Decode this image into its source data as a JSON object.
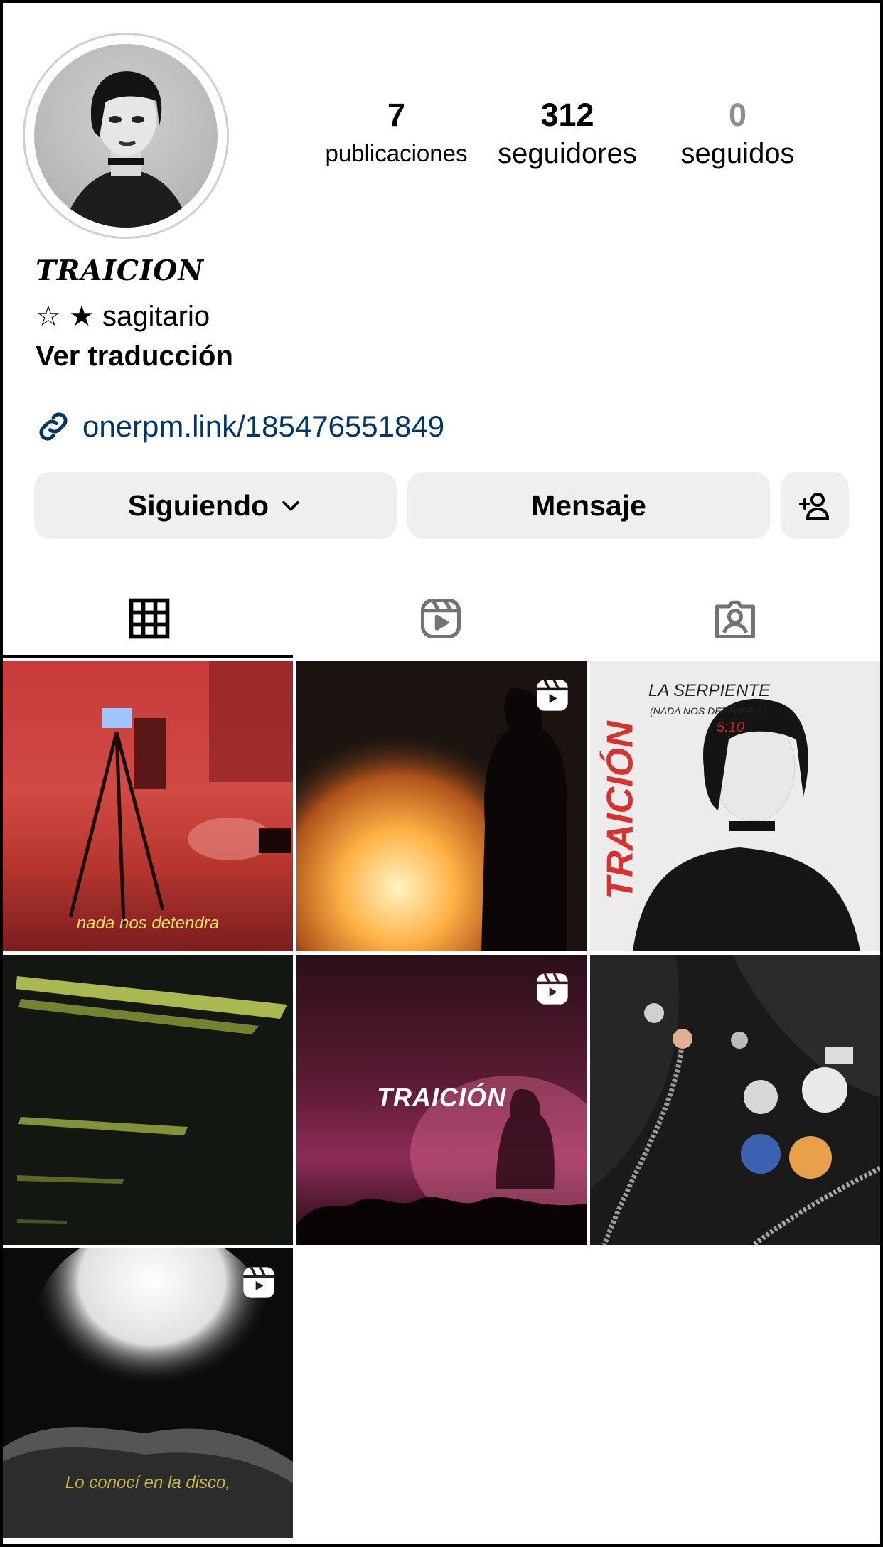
{
  "profile": {
    "display_name": "TRAICION",
    "bio_line": "☆ ★ sagitario",
    "translate_label": "Ver traducción",
    "link": "onerpm.link/185476551849"
  },
  "stats": {
    "posts": {
      "value": "7",
      "label": "publicaciones"
    },
    "followers": {
      "value": "312",
      "label": "seguidores"
    },
    "following": {
      "value": "0",
      "label": "seguidos"
    }
  },
  "actions": {
    "following_label": "Siguiendo",
    "message_label": "Mensaje"
  },
  "tabs": [
    {
      "icon": "grid-icon",
      "active": true
    },
    {
      "icon": "reels-icon",
      "active": false
    },
    {
      "icon": "tagged-icon",
      "active": false
    }
  ],
  "posts": [
    {
      "type": "image",
      "caption": "nada nos detendra"
    },
    {
      "type": "reel"
    },
    {
      "type": "image",
      "title": "TRAICIÓN",
      "subtitle": "LA SERPIENTE",
      "subnote": "(NADA NOS DETENDRÁ)",
      "date": "5:10"
    },
    {
      "type": "image"
    },
    {
      "type": "reel",
      "title": "TRAICIÓN"
    },
    {
      "type": "image"
    },
    {
      "type": "reel",
      "caption": "Lo conocí en la disco,"
    }
  ],
  "colors": {
    "link": "#00376b",
    "button_bg": "#efefef",
    "muted": "#8e8e8e"
  }
}
